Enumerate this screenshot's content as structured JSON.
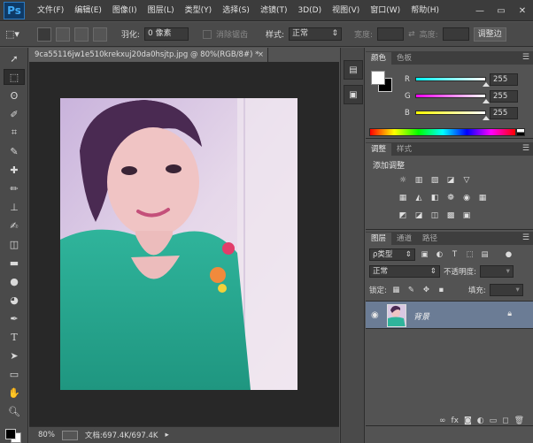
{
  "app": {
    "logo": "Ps"
  },
  "menu": [
    "文件(F)",
    "编辑(E)",
    "图像(I)",
    "图层(L)",
    "类型(Y)",
    "选择(S)",
    "滤镜(T)",
    "3D(D)",
    "视图(V)",
    "窗口(W)",
    "帮助(H)"
  ],
  "window_controls": {
    "minimize": "—",
    "restore": "▭",
    "close": "✕"
  },
  "options": {
    "feather_label": "羽化:",
    "feather_value": "0 像素",
    "antialias_label": "消除锯齿",
    "style_label": "样式:",
    "style_value": "正常",
    "width_label": "宽度:",
    "height_label": "高度:",
    "refine_edge": "调整边"
  },
  "document": {
    "tab_title": "9ca55116jw1e510krekxuj20da0hsjtp.jpg @ 80%(RGB/8#) *",
    "close": "×",
    "zoom": "80%",
    "doc_info": "文档:697.4K/697.4K"
  },
  "color_panel": {
    "tabs": [
      "颜色",
      "色板"
    ],
    "channels": [
      {
        "label": "R",
        "value": "255",
        "fraction": 1.0,
        "gradient": [
          "#00ffff",
          "#ffffff"
        ]
      },
      {
        "label": "G",
        "value": "255",
        "fraction": 1.0,
        "gradient": [
          "#ff00ff",
          "#ffffff"
        ]
      },
      {
        "label": "B",
        "value": "255",
        "fraction": 1.0,
        "gradient": [
          "#ffff00",
          "#ffffff"
        ]
      }
    ]
  },
  "adjust_panel": {
    "tabs": [
      "调整",
      "样式"
    ],
    "title": "添加调整",
    "row1": [
      "☼",
      "▥",
      "▨",
      "◪",
      "▽"
    ],
    "row2": [
      "▦",
      "◭",
      "◧",
      "❁",
      "◉",
      "▦"
    ],
    "row3": [
      "◩",
      "◪",
      "◫",
      "▩",
      "▣"
    ]
  },
  "layers_panel": {
    "tabs": [
      "图层",
      "通道",
      "路径"
    ],
    "filter_label": "ρ类型",
    "blend_mode": "正常",
    "opacity_label": "不透明度:",
    "lock_label": "锁定:",
    "fill_label": "填充:",
    "layer_name": "背景"
  },
  "colors": {
    "accent_selected": "#6b7c95",
    "menubar_bg": "#3c3c3c",
    "canvas_bg": "#282828"
  }
}
